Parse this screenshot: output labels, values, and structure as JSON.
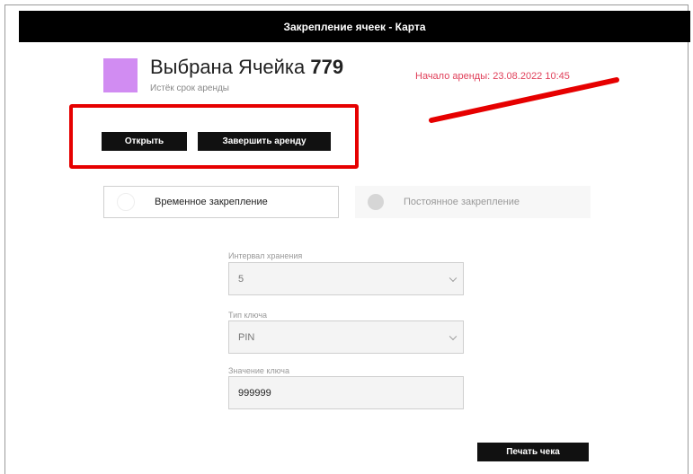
{
  "header": {
    "title": "Закрепление ячеек - Карта"
  },
  "cell": {
    "color": "#d18cf2",
    "title_prefix": "Выбрана Ячейка",
    "number": "779",
    "status": "Истёк срок аренды"
  },
  "rent_start": "Начало аренды: 23.08.2022 10:45",
  "actions": {
    "open_label": "Открыть",
    "end_rent_label": "Завершить аренду"
  },
  "mode": {
    "temporary_label": "Временное закрепление",
    "permanent_label": "Постоянное закрепление"
  },
  "form": {
    "storage_interval": {
      "label": "Интервал хранения",
      "value": "5"
    },
    "key_type": {
      "label": "Тип ключа",
      "value": "PIN"
    },
    "key_value": {
      "label": "Значение ключа",
      "value": "999999"
    }
  },
  "print_label": "Печать чека",
  "annotation_color": "#e60000"
}
